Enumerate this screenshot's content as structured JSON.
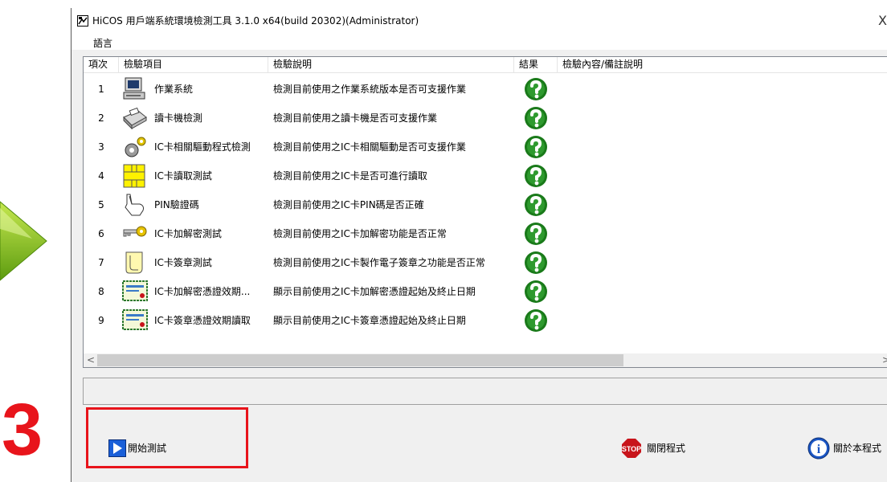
{
  "step_number": "3",
  "window": {
    "title": "HiCOS 用戶端系統環境檢測工具 3.1.0 x64(build 20302)(Administrator)",
    "close_glyph": "X"
  },
  "menu": {
    "language": "語言"
  },
  "columns": [
    "項次",
    "檢驗項目",
    "檢驗說明",
    "結果",
    "檢驗內容/備註說明"
  ],
  "rows": [
    {
      "no": "1",
      "item": "作業系統",
      "desc": "檢測目前使用之作業系統版本是否可支援作業",
      "icon": "computer-icon",
      "result": "unknown"
    },
    {
      "no": "2",
      "item": "讀卡機檢測",
      "desc": "檢測目前使用之讀卡機是否可支援作業",
      "icon": "card-reader-icon",
      "result": "unknown"
    },
    {
      "no": "3",
      "item": "IC卡相關驅動程式檢測",
      "desc": "檢測目前使用之IC卡相關驅動是否可支援作業",
      "icon": "gears-icon",
      "result": "unknown"
    },
    {
      "no": "4",
      "item": "IC卡讀取測試",
      "desc": "檢測目前使用之IC卡是否可進行讀取",
      "icon": "chip-icon",
      "result": "unknown"
    },
    {
      "no": "5",
      "item": "PIN驗證碼",
      "desc": "檢測目前使用之IC卡PIN碼是否正確",
      "icon": "pointer-hand-icon",
      "result": "unknown"
    },
    {
      "no": "6",
      "item": "IC卡加解密測試",
      "desc": "檢測目前使用之IC卡加解密功能是否正常",
      "icon": "key-icon",
      "result": "unknown"
    },
    {
      "no": "7",
      "item": "IC卡簽章測試",
      "desc": "檢測目前使用之IC卡製作電子簽章之功能是否正常",
      "icon": "scroll-icon",
      "result": "unknown"
    },
    {
      "no": "8",
      "item": "IC卡加解密憑證效期...",
      "desc": "顯示目前使用之IC卡加解密憑證起始及終止日期",
      "icon": "certificate-icon",
      "result": "unknown"
    },
    {
      "no": "9",
      "item": "IC卡簽章憑證效期讀取",
      "desc": "顯示目前使用之IC卡簽章憑證起始及終止日期",
      "icon": "certificate-icon",
      "result": "unknown"
    }
  ],
  "scrollbar": {
    "left_arrow": "<",
    "right_arrow": ">"
  },
  "buttons": {
    "start": "開始測試",
    "stop_badge": "STOP",
    "close": "關閉程式",
    "about": "關於本程式",
    "info_glyph": "i"
  },
  "colors": {
    "accent_red": "#e8141b",
    "result_green": "#1a7a1a",
    "arrow_green": "#7cbf1c",
    "start_blue": "#1a5fd8"
  }
}
